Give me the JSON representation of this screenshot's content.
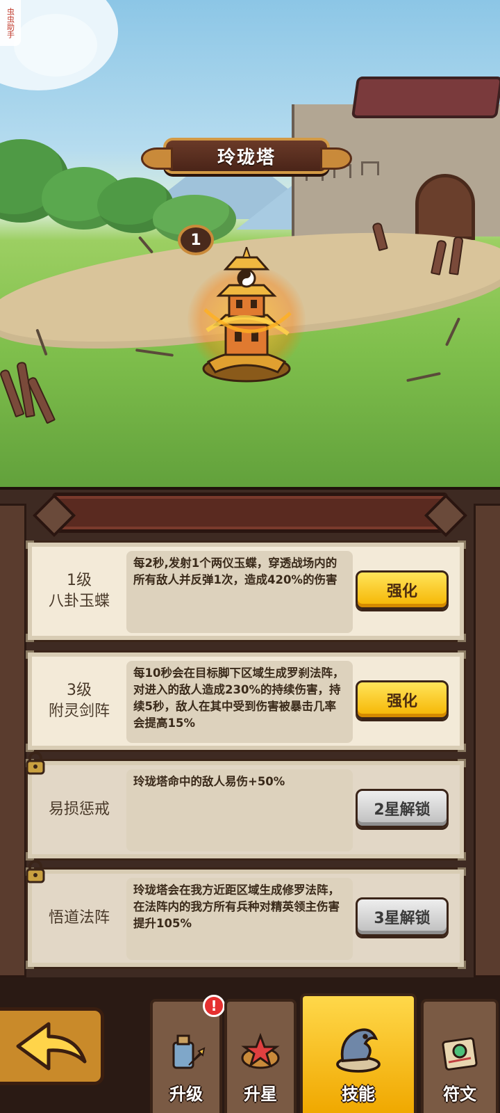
{
  "watermark": "虫虫助手",
  "tower": {
    "name": "玲珑塔",
    "level": "1"
  },
  "skills": [
    {
      "level_label": "1级",
      "name": "八卦玉蝶",
      "description": "每2秒,发射1个两仪玉蝶，穿透战场内的所有敌人并反弹1次，造成420%的伤害",
      "button_label": "强化",
      "locked": false
    },
    {
      "level_label": "3级",
      "name": "附灵剑阵",
      "description": "每10秒会在目标脚下区域生成罗刹法阵，对进入的敌人造成230%的持续伤害，持续5秒，敌人在其中受到伤害被暴击几率会提高15%",
      "button_label": "强化",
      "locked": false
    },
    {
      "level_label": "",
      "name": "易损惩戒",
      "description": "玲珑塔命中的敌人易伤+50%",
      "button_label": "2星解锁",
      "locked": true
    },
    {
      "level_label": "",
      "name": "悟道法阵",
      "description": "玲珑塔会在我方近距区域生成修罗法阵，在法阵内的我方所有兵种对精英领主伤害提升105%",
      "button_label": "3星解锁",
      "locked": true
    }
  ],
  "tabs": [
    {
      "label": "升级",
      "icon": "potion-upgrade-icon",
      "badge": "!"
    },
    {
      "label": "升星",
      "icon": "star-emblem-icon"
    },
    {
      "label": "技能",
      "icon": "dragon-skill-icon",
      "active": true
    },
    {
      "label": "符文",
      "icon": "rune-scroll-icon"
    }
  ],
  "colors": {
    "gold_button": "#f5b400",
    "grey_button": "#bdbdbd",
    "panel_bg": "#3e2a22",
    "card_bg": "#f3ead8"
  }
}
